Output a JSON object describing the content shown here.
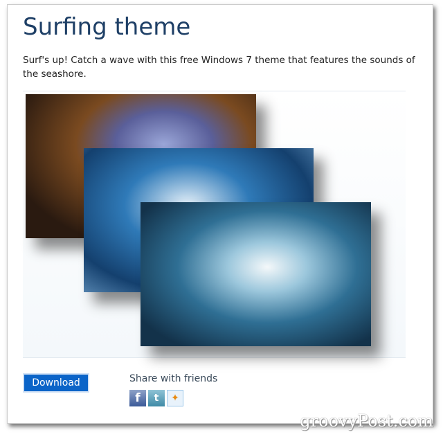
{
  "page": {
    "title": "Surfing theme",
    "description": "Surf's up! Catch a wave with this free Windows 7 theme that features the sounds of the seashore."
  },
  "preview": {
    "images": [
      "cave-wave-image",
      "blue-wave-image",
      "surfer-tube-image"
    ]
  },
  "actions": {
    "download_label": "Download"
  },
  "share": {
    "label": "Share with friends",
    "icons": [
      {
        "name": "facebook-icon",
        "glyph": "f"
      },
      {
        "name": "twitter-icon",
        "glyph": "t"
      },
      {
        "name": "messenger-icon",
        "glyph": "✦"
      }
    ]
  },
  "watermark": "groovyPost.com",
  "colors": {
    "title": "#1e3f66",
    "button": "#0b64c8"
  }
}
